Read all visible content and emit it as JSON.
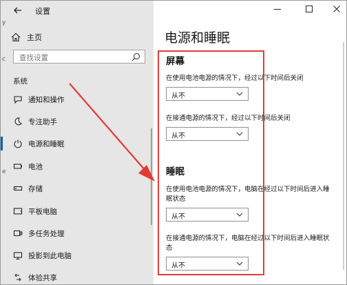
{
  "window": {
    "title": "设置",
    "edge_marks": [
      "y",
      "c",
      "e"
    ]
  },
  "sidebar": {
    "home_label": "主页",
    "search_placeholder": "查找设置",
    "section_label": "系统",
    "items": [
      {
        "label": "通知和操作",
        "icon": "notification-icon"
      },
      {
        "label": "专注助手",
        "icon": "moon-icon"
      },
      {
        "label": "电源和睡眠",
        "icon": "power-icon",
        "selected": true
      },
      {
        "label": "电池",
        "icon": "battery-icon"
      },
      {
        "label": "存储",
        "icon": "storage-icon"
      },
      {
        "label": "平板电脑",
        "icon": "tablet-icon"
      },
      {
        "label": "多任务处理",
        "icon": "multitask-icon"
      },
      {
        "label": "投影到此电脑",
        "icon": "project-icon"
      },
      {
        "label": "体验共享",
        "icon": "share-icon"
      }
    ]
  },
  "main": {
    "page_title": "电源和睡眠",
    "screen": {
      "heading": "屏幕",
      "battery_desc": "在使用电池电源的情况下，经过以下时间后关闭",
      "battery_value": "从不",
      "plugged_desc": "在接通电源的情况下，经过以下时间后关闭",
      "plugged_value": "从不"
    },
    "sleep": {
      "heading": "睡眠",
      "battery_desc": "在使用电池电源的情况下，电脑在经过以下时间后进入睡眠状态",
      "battery_value": "从不",
      "plugged_desc": "在接通电源的情况下，电脑在经过以下时间后进入睡眠状态",
      "plugged_value": "从不"
    }
  },
  "colors": {
    "sidebar_bg": "#e6e6e6",
    "accent": "#0063b1",
    "annotation": "#e53935"
  }
}
